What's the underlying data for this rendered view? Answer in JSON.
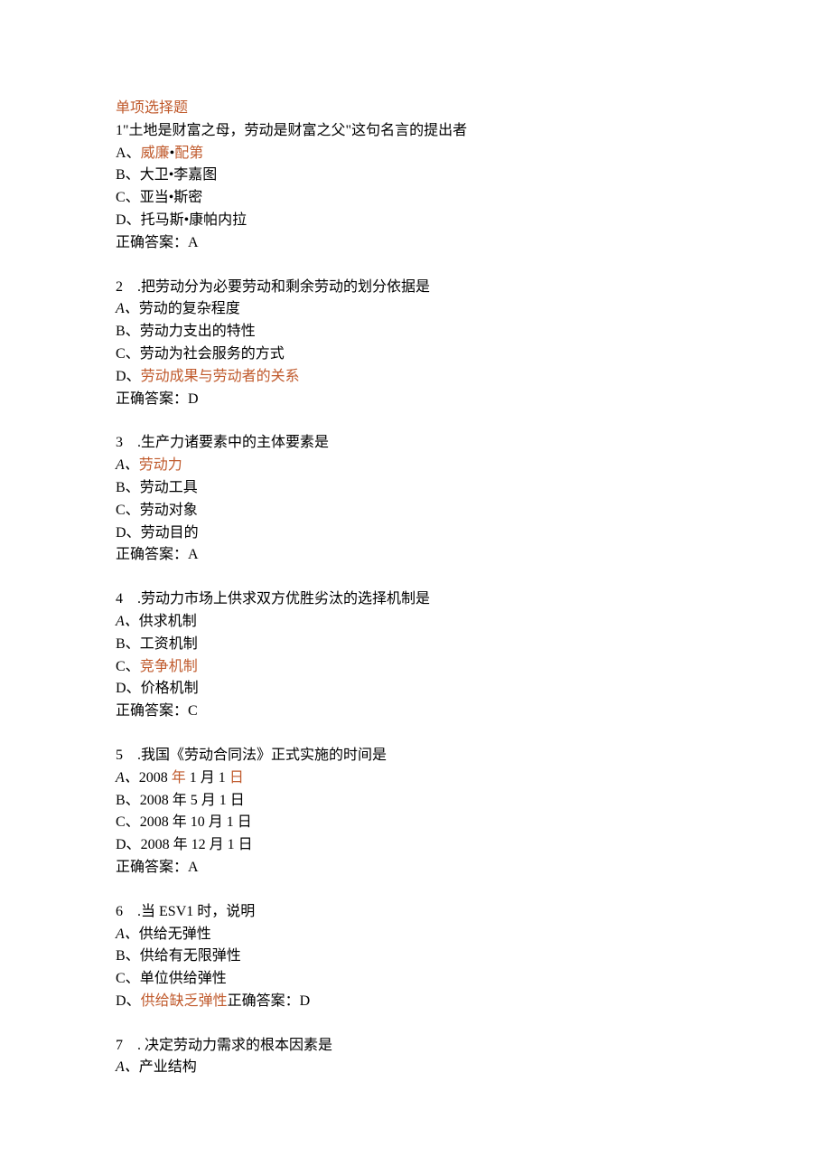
{
  "section_title": "单项选择题",
  "questions": [
    {
      "num_prefix": "1\"",
      "stem_plain": "土地是财富之母，劳动是财富之父\"这句名言的提出者",
      "options": [
        {
          "label": "A、",
          "pre": "",
          "hi": "威廉",
          "mid": "•",
          "hi2": "配第",
          "post": ""
        },
        {
          "label": "B、",
          "pre": "大卫•李嘉图"
        },
        {
          "label": "C、",
          "pre": "亚当•斯密"
        },
        {
          "label": "D、",
          "pre": "托马斯•康帕内拉"
        }
      ],
      "answer": "正确答案：A"
    },
    {
      "num_prefix": "2　.",
      "stem_plain": "把劳动分为必要劳动和剩余劳动的划分依据是",
      "options": [
        {
          "label": "A、",
          "pre": "劳动的复杂程度",
          "italic_label": true
        },
        {
          "label": "B、",
          "pre": "劳动力支出的特性"
        },
        {
          "label": "C、",
          "pre": "劳动为社会服务的方式"
        },
        {
          "label": "D、",
          "pre": "",
          "hi": "劳动成果与劳动者的关系"
        }
      ],
      "answer": "正确答案：D"
    },
    {
      "num_prefix": "3　.",
      "stem_plain": "生产力诸要素中的主体要素是",
      "options": [
        {
          "label": "A、",
          "pre": "",
          "hi": "劳动力",
          "italic_label": true
        },
        {
          "label": "B、",
          "pre": "劳动工具"
        },
        {
          "label": "C、",
          "pre": "劳动对象"
        },
        {
          "label": "D、",
          "pre": "劳动目的"
        }
      ],
      "answer": "正确答案：A"
    },
    {
      "num_prefix": "4　.",
      "stem_plain": "劳动力市场上供求双方优胜劣汰的选择机制是",
      "options": [
        {
          "label": "A、",
          "pre": "供求机制",
          "italic_label": true
        },
        {
          "label": "B、",
          "pre": "工资机制"
        },
        {
          "label": "C、",
          "pre": "",
          "hi": "竞争机制"
        },
        {
          "label": "D、",
          "pre": "价格机制"
        }
      ],
      "answer": "正确答案：C"
    },
    {
      "num_prefix": "5　.",
      "stem_plain": "我国《劳动合同法》正式实施的时间是",
      "options": [
        {
          "label": "A、",
          "pre": "2008 ",
          "hi": "年",
          "mid": " 1 月 1 ",
          "hi2": "日",
          "italic_label": true
        },
        {
          "label": "B、",
          "pre": "2008 年 5 月 1 日"
        },
        {
          "label": "C、",
          "pre": "2008 年 10 月 1 日"
        },
        {
          "label": "D、",
          "pre": "2008 年 12 月 1 日"
        }
      ],
      "answer": "正确答案：A"
    },
    {
      "num_prefix": "6　.",
      "stem_plain": "当 ESV1 时，说明",
      "options": [
        {
          "label": "A、",
          "pre": "供给无弹性",
          "italic_label": true
        },
        {
          "label": "B、",
          "pre": "供给有无限弹性"
        },
        {
          "label": "C、",
          "pre": "单位供给弹性"
        },
        {
          "label": "D、",
          "pre": "",
          "hi": "供给缺乏弹性",
          "post": "正确答案：D"
        }
      ],
      "answer": ""
    },
    {
      "num_prefix": "7　. ",
      "stem_plain": "决定劳动力需求的根本因素是",
      "options": [
        {
          "label": "A、",
          "pre": "产业结构",
          "italic_label": true
        }
      ],
      "answer": ""
    }
  ]
}
